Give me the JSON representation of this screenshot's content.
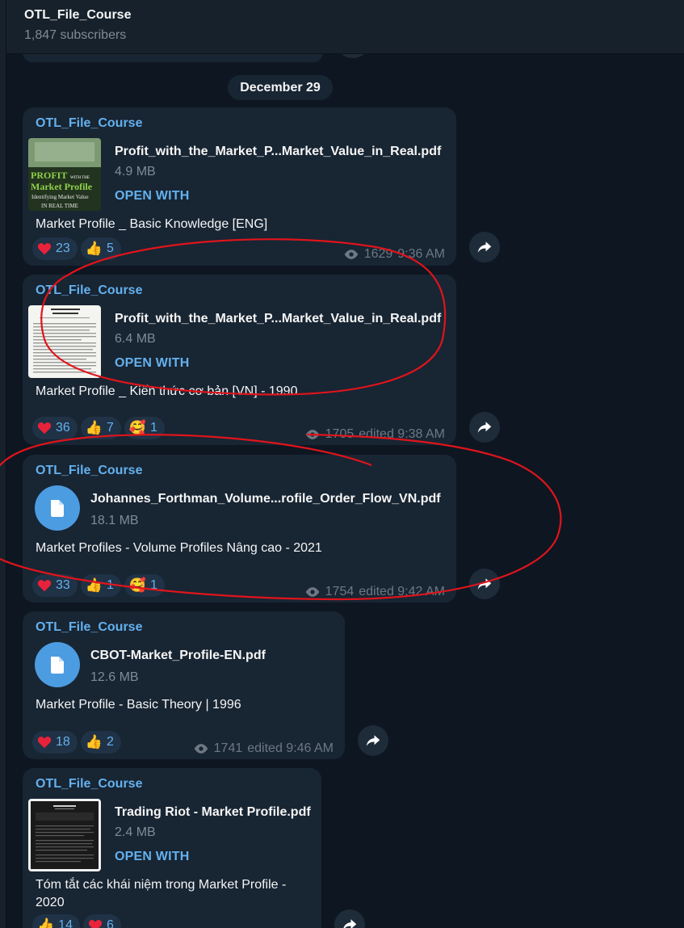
{
  "header": {
    "title": "OTL_File_Course",
    "subscribers": "1,847 subscribers"
  },
  "date_separator": "December 29",
  "messages": [
    {
      "author": "OTL_File_Course",
      "file_name": "Profit_with_the_Market_P...Market_Value_in_Real.pdf",
      "file_size": "4.9 MB",
      "open_with": "OPEN WITH",
      "caption": "Market Profile _ Basic Knowledge [ENG]",
      "thumb_text": [
        "PROFIT",
        "WITH THE",
        "Market Profile",
        "Identifying Market Value",
        "IN REAL TIME"
      ],
      "reactions": [
        {
          "emoji": "heart",
          "count": "23"
        },
        {
          "emoji": "thumbs-up",
          "count": "5"
        }
      ],
      "views": "1629",
      "time": "9:36 AM"
    },
    {
      "author": "OTL_File_Course",
      "file_name": "Profit_with_the_Market_P...Market_Value_in_Real.pdf",
      "file_size": "6.4 MB",
      "open_with": "OPEN WITH",
      "caption": "Market Profile _ Kiến thức cơ bản [VN] - 1990",
      "reactions": [
        {
          "emoji": "heart",
          "count": "36"
        },
        {
          "emoji": "thumbs-up",
          "count": "7"
        },
        {
          "emoji": "smiling-face-hearts",
          "count": "1"
        }
      ],
      "views": "1705",
      "time": "edited 9:38 AM"
    },
    {
      "author": "OTL_File_Course",
      "file_name": "Johannes_Forthman_Volume...rofile_Order_Flow_VN.pdf",
      "file_size": "18.1 MB",
      "caption": "Market Profiles - Volume Profiles Nâng cao - 2021",
      "reactions": [
        {
          "emoji": "heart",
          "count": "33"
        },
        {
          "emoji": "thumbs-up",
          "count": "1"
        },
        {
          "emoji": "smiling-face-hearts",
          "count": "1"
        }
      ],
      "views": "1754",
      "time": "edited 9:42 AM"
    },
    {
      "author": "OTL_File_Course",
      "file_name": "CBOT-Market_Profile-EN.pdf",
      "file_size": "12.6 MB",
      "caption": "Market Profile - Basic Theory | 1996",
      "reactions": [
        {
          "emoji": "heart",
          "count": "18"
        },
        {
          "emoji": "thumbs-up",
          "count": "2"
        }
      ],
      "views": "1741",
      "time": "edited 9:46 AM"
    },
    {
      "author": "OTL_File_Course",
      "file_name": "Trading Riot - Market Profile.pdf",
      "file_size": "2.4 MB",
      "open_with": "OPEN WITH",
      "caption_line1": "Tóm tắt các khái niệm trong Market Profile -",
      "caption_line2": "2020",
      "reactions": [
        {
          "emoji": "thumbs-up",
          "count": "14"
        },
        {
          "emoji": "heart",
          "count": "6"
        }
      ]
    }
  ],
  "colors": {
    "background": "#0e1621",
    "bubble": "#182533",
    "accent": "#64b1ee",
    "annotation": "#e0141b"
  }
}
